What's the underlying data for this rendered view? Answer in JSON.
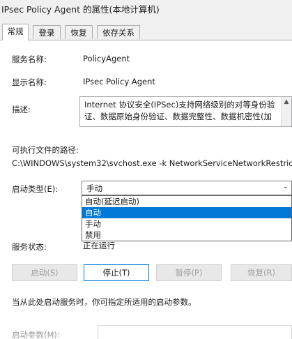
{
  "window": {
    "title": "IPsec Policy Agent 的属性(本地计算机)"
  },
  "tabs": [
    {
      "label": "常规"
    },
    {
      "label": "登录"
    },
    {
      "label": "恢复"
    },
    {
      "label": "依存关系"
    }
  ],
  "general": {
    "service_name_label": "服务名称:",
    "service_name_value": "PolicyAgent",
    "display_name_label": "显示名称:",
    "display_name_value": "IPsec Policy Agent",
    "description_label": "描述:",
    "description_value": "Internet 协议安全(IPSec)支持网络级别的对等身份验证、数据原始身份验证、数据完整性、数据机密性(加",
    "exe_path_label": "可执行文件的路径:",
    "exe_path_value": "C:\\WINDOWS\\system32\\svchost.exe -k NetworkServiceNetworkRestric",
    "startup_type_label": "启动类型(E):",
    "startup_type_value": "手动",
    "startup_options": [
      "自动(延迟启动)",
      "自动",
      "手动",
      "禁用"
    ],
    "startup_selected_option": "自动",
    "status_label": "服务状态:",
    "status_value": "正在运行",
    "hint": "当从此处启动服务时，你可指定所适用的启动参数。",
    "start_params_label": "启动参数(M):"
  },
  "buttons": {
    "start": "启动(S)",
    "stop": "停止(T)",
    "pause": "暂停(P)",
    "resume": "恢复(R)"
  },
  "colors": {
    "selection": "#0078d7",
    "panel_bg": "#ffffff",
    "window_bg": "#f0f0f0"
  }
}
